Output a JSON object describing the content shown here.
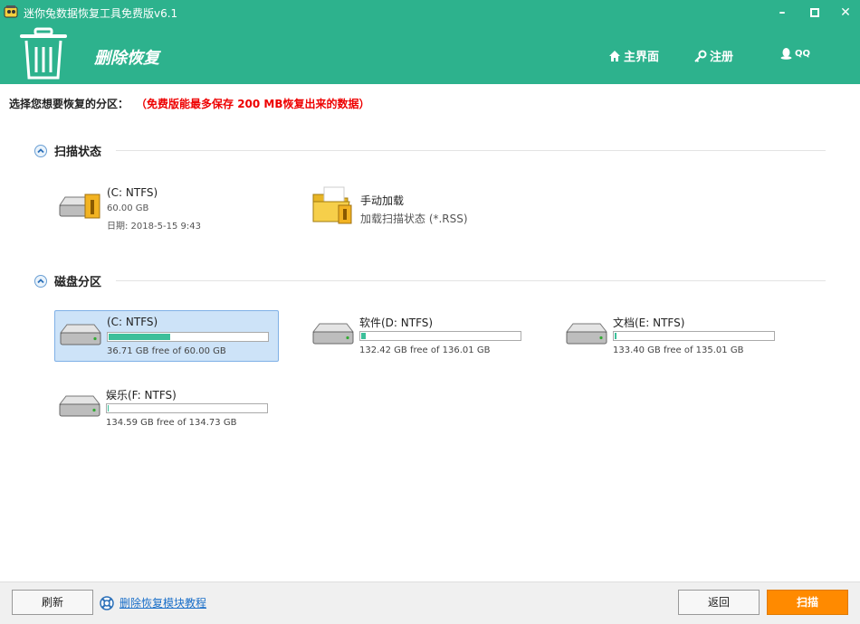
{
  "window": {
    "title": "迷你兔数据恢复工具免费版v6.1"
  },
  "header": {
    "module_title": "删除恢复",
    "nav": [
      {
        "label": "主界面",
        "icon": "home-icon"
      },
      {
        "label": "注册",
        "icon": "key-icon"
      },
      {
        "label": "QQ",
        "icon": "qq-penguin-icon"
      }
    ]
  },
  "prompt": {
    "text": "选择您想要恢复的分区：",
    "note": "（免费版能最多保存 200 MB恢复出来的数据）"
  },
  "scan_section": {
    "title": "扫描状态",
    "items": [
      {
        "name": "(C: NTFS)",
        "size": "60.00 GB",
        "date": "日期: 2018-5-15 9:43"
      },
      {
        "name": "手动加载",
        "desc": "加载扫描状态 (*.RSS)"
      }
    ]
  },
  "disk_section": {
    "title": "磁盘分区",
    "partitions": [
      {
        "name": "(C: NTFS)",
        "free_text": "36.71 GB free of 60.00 GB",
        "used_fraction": 0.388,
        "selected": true
      },
      {
        "name": "软件(D: NTFS)",
        "free_text": "132.42 GB free of 136.01 GB",
        "used_fraction": 0.026,
        "selected": false
      },
      {
        "name": "文档(E: NTFS)",
        "free_text": "133.40 GB free of 135.01 GB",
        "used_fraction": 0.012,
        "selected": false
      },
      {
        "name": "娱乐(F: NTFS)",
        "free_text": "134.59 GB free of 134.73 GB",
        "used_fraction": 0.001,
        "selected": false
      }
    ]
  },
  "bottom": {
    "refresh_label": "刷新",
    "help_link": "删除恢复模块教程",
    "back_label": "返回",
    "scan_label": "扫描"
  },
  "colors": {
    "theme_green": "#2db28d",
    "scan_orange": "#ff8a00",
    "usage_fill": "#3cbf9a",
    "note_red": "#e00000"
  }
}
